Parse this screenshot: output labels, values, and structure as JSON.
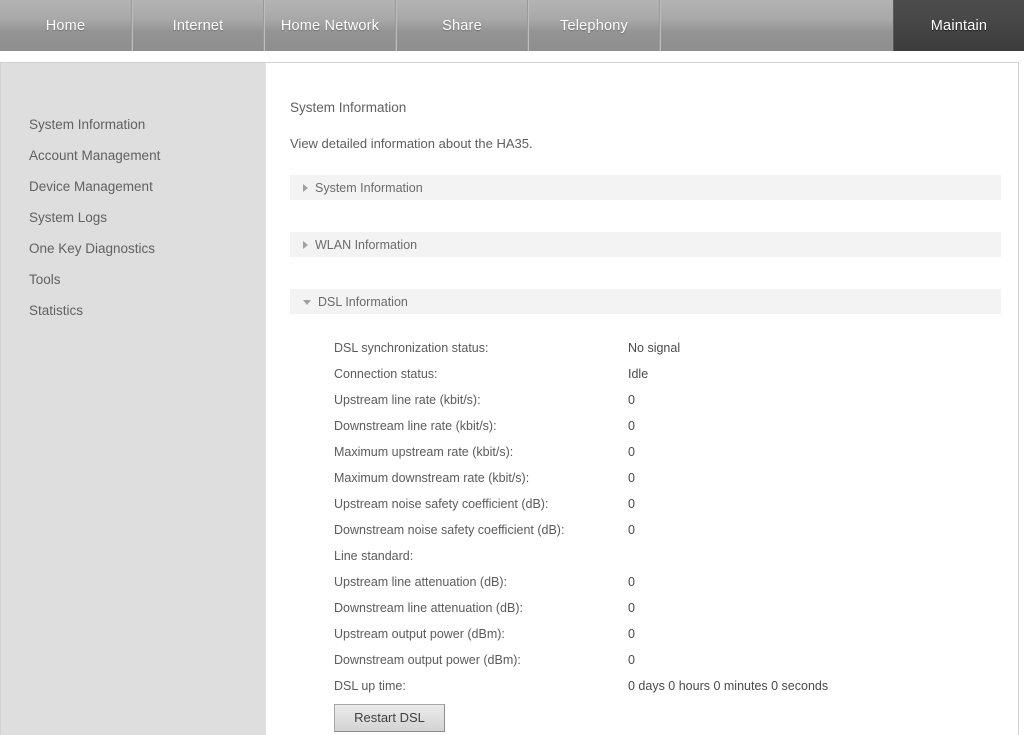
{
  "nav": {
    "tabs": [
      {
        "label": "Home",
        "active": false
      },
      {
        "label": "Internet",
        "active": false
      },
      {
        "label": "Home Network",
        "active": false
      },
      {
        "label": "Share",
        "active": false
      },
      {
        "label": "Telephony",
        "active": false
      },
      {
        "label": "Maintain",
        "active": true
      }
    ]
  },
  "sidebar": {
    "items": [
      {
        "label": "System Information"
      },
      {
        "label": "Account Management"
      },
      {
        "label": "Device Management"
      },
      {
        "label": "System Logs"
      },
      {
        "label": "One Key Diagnostics"
      },
      {
        "label": "Tools"
      },
      {
        "label": "Statistics"
      }
    ]
  },
  "main": {
    "title": "System Information",
    "description": "View detailed information about the HA35.",
    "sections": [
      {
        "label": "System Information",
        "expanded": false,
        "icon": "chevron-right-icon"
      },
      {
        "label": "WLAN Information",
        "expanded": false,
        "icon": "chevron-right-icon"
      },
      {
        "label": "DSL Information",
        "expanded": true,
        "icon": "chevron-down-icon"
      }
    ],
    "dsl_rows": [
      {
        "label": "DSL synchronization status:",
        "value": "No signal"
      },
      {
        "label": "Connection status:",
        "value": "Idle"
      },
      {
        "label": "Upstream line rate (kbit/s):",
        "value": "0"
      },
      {
        "label": "Downstream line rate (kbit/s):",
        "value": "0"
      },
      {
        "label": "Maximum upstream rate (kbit/s):",
        "value": "0"
      },
      {
        "label": "Maximum downstream rate (kbit/s):",
        "value": "0"
      },
      {
        "label": "Upstream noise safety coefficient (dB):",
        "value": "0"
      },
      {
        "label": "Downstream noise safety coefficient (dB):",
        "value": "0"
      },
      {
        "label": "Line standard:",
        "value": ""
      },
      {
        "label": "Upstream line attenuation (dB):",
        "value": "0"
      },
      {
        "label": "Downstream line attenuation (dB):",
        "value": "0"
      },
      {
        "label": "Upstream output power (dBm):",
        "value": "0"
      },
      {
        "label": "Downstream output power (dBm):",
        "value": "0"
      },
      {
        "label": "DSL up time:",
        "value": "0 days 0 hours 0 minutes 0 seconds"
      }
    ],
    "restart_button": "Restart DSL"
  },
  "colors": {
    "nav_active": "#464646",
    "nav_bg": "#a8a8a8",
    "sidebar_bg": "#dedede",
    "section_bar": "#f3f3f3"
  }
}
